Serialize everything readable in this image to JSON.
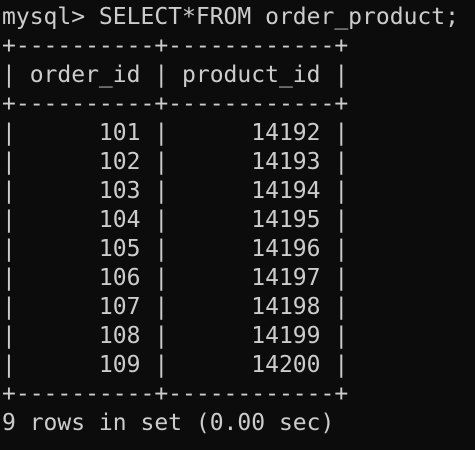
{
  "terminal": {
    "lines": [
      "mysql> SELECT*FROM order_product;",
      "+----------+------------+",
      "| order_id | product_id |",
      "+----------+------------+",
      "|      101 |      14192 |",
      "|      102 |      14193 |",
      "|      103 |      14194 |",
      "|      104 |      14195 |",
      "|      105 |      14196 |",
      "|      106 |      14197 |",
      "|      107 |      14198 |",
      "|      108 |      14199 |",
      "|      109 |      14200 |",
      "+----------+------------+",
      "9 rows in set (0.00 sec)"
    ]
  }
}
